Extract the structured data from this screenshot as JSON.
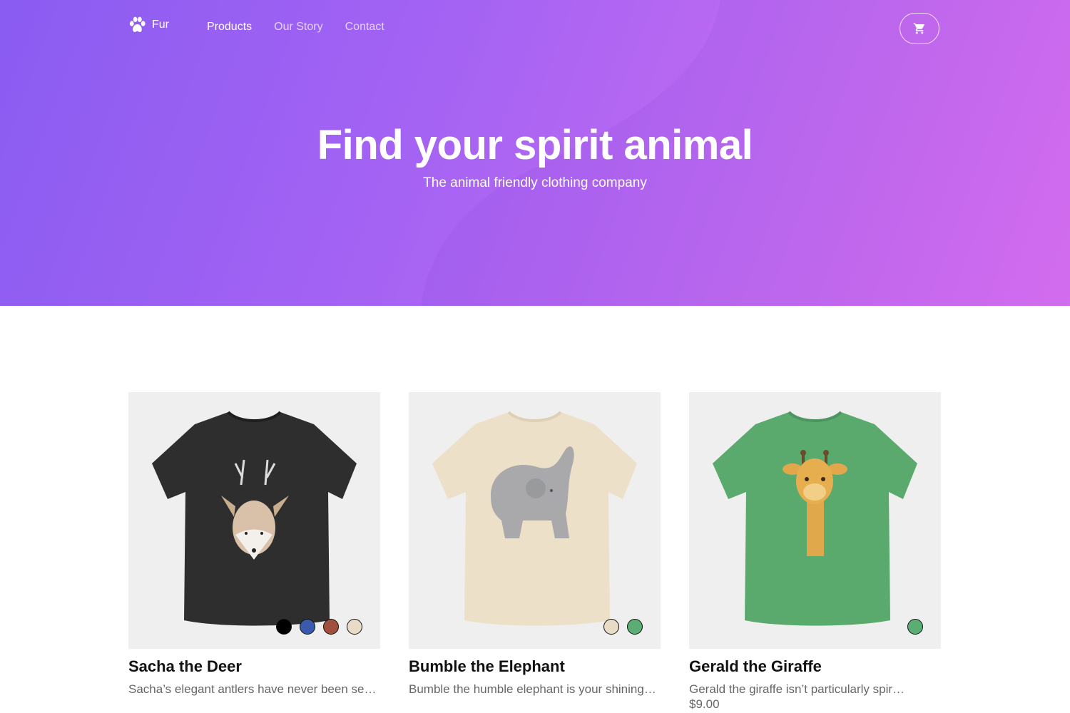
{
  "brand": {
    "name": "Fur",
    "icon": "paw-icon"
  },
  "nav": {
    "links": [
      {
        "label": "Products",
        "active": true
      },
      {
        "label": "Our Story",
        "active": false
      },
      {
        "label": "Contact",
        "active": false
      }
    ],
    "cart_icon": "cart-icon"
  },
  "hero": {
    "title": "Find your spirit animal",
    "subtitle": "The animal friendly clothing company"
  },
  "products": [
    {
      "name": "Sacha the Deer",
      "description": "Sacha’s elegant antlers have never been se…",
      "shirt_color": "#2e2e2e",
      "swatches": [
        "#000000",
        "#3a5bad",
        "#a0503d",
        "#e8dcc6"
      ]
    },
    {
      "name": "Bumble the Elephant",
      "description": "Bumble the humble elephant is your shining…",
      "shirt_color": "#ece0c8",
      "swatches": [
        "#e8dcc6",
        "#5aad73"
      ]
    },
    {
      "name": "Gerald the Giraffe",
      "description": "Gerald the giraffe isn’t particularly spir…",
      "price": "$9.00",
      "shirt_color": "#5aa96d",
      "swatches": [
        "#5aad73"
      ]
    }
  ],
  "colors": {
    "hero_start": "#8a5cf2",
    "hero_end": "#de72f2"
  }
}
